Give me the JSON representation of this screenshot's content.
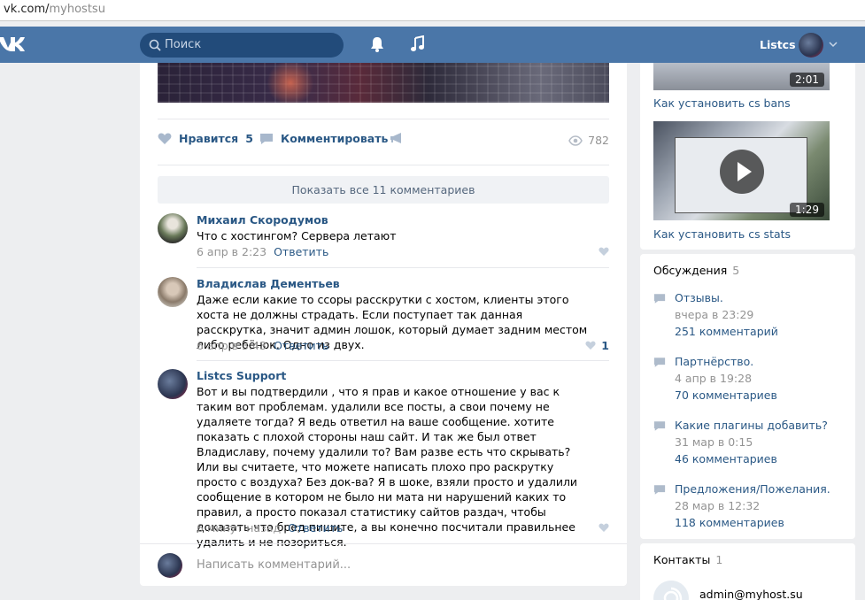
{
  "browser": {
    "url_host": "vk.com/",
    "url_path": "myhostsu"
  },
  "header": {
    "search_placeholder": "Поиск",
    "user_name": "Listcs"
  },
  "post": {
    "like_label": "Нравится",
    "like_count": "5",
    "comment_label": "Комментировать",
    "views": "782",
    "show_all": "Показать все 11 комментариев"
  },
  "comments": [
    {
      "author": "Михаил Скородумов",
      "text": "Что с хостингом? Сервера летают",
      "date": "6 апр в 2:23",
      "reply": "Ответить",
      "likes": ""
    },
    {
      "author": "Владислав Дементьев",
      "text": "Даже если какие то ссоры расскрутки с хостом, клиенты этого хоста не должны страдать. Если поступает так данная расскрутка, значит админ лошок, который думает задним местом либо ребёнок. Одно из двух.",
      "date": "6 апр в 3:43",
      "reply": "Ответить",
      "likes": "1"
    },
    {
      "author": "Listcs Support",
      "text": "Вот и вы подтвердили , что я прав и какое отношение у вас к таким вот проблемам. удалили все посты, а свои почему не удаляете тогда? Я ведь ответил на ваше сообщение. хотите показать с плохой стороны наш сайт. И так же был ответ Владиславу, почему удалили то? Вам разве есть что скрывать? Или вы считаете, что можете написать плохо про раскрутку просто с воздуха? Без док-ва? Я в шоке, взяли просто и удалили сообщение в котором не было ни мата ни нарушений каких то правил, а просто показал статистику сайтов раздач, чтобы доказать что бред пишите, а вы конечно посчитали правильнее удалить и не позориться.",
      "date": "6 минут назад",
      "reply": "Ответить",
      "likes": ""
    }
  ],
  "write_placeholder": "Написать комментарий...",
  "videos": [
    {
      "duration": "2:01",
      "title": "Как установить cs bans"
    },
    {
      "duration": "1:29",
      "title": "Как установить cs stats"
    }
  ],
  "discussions": {
    "title": "Обсуждения",
    "count": "5",
    "items": [
      {
        "title": "Отзывы.",
        "date": "вчера в 23:29",
        "comments": "251 комментарий"
      },
      {
        "title": "Партнёрство.",
        "date": "4 апр в 19:28",
        "comments": "70 комментариев"
      },
      {
        "title": "Какие плагины добавить?",
        "date": "31 мар в 0:15",
        "comments": "46 комментариев"
      },
      {
        "title": "Предложения/Пожелания.",
        "date": "28 мар в 12:32",
        "comments": "118 комментариев"
      }
    ]
  },
  "contacts": {
    "title": "Контакты",
    "count": "1",
    "email": "admin@myhost.su"
  }
}
